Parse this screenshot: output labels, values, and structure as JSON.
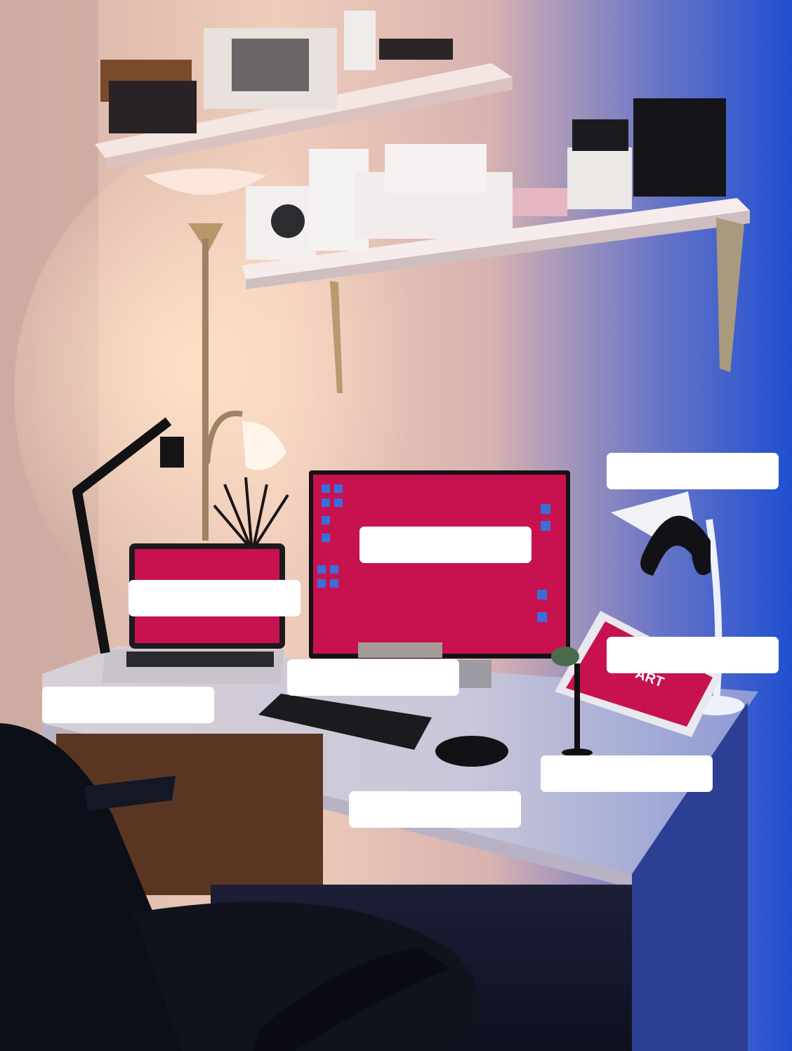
{
  "photo": {
    "subject": "",
    "tablet_text": "ART"
  },
  "labels": [
    "",
    "",
    "",
    "",
    "",
    "",
    "",
    ""
  ],
  "colors": {
    "screen": "#c8124f",
    "wall_warm": "#e9c3b0",
    "wall_cool": "#2f59c2",
    "desk": "#dcd7df",
    "shadow": "#101528"
  }
}
